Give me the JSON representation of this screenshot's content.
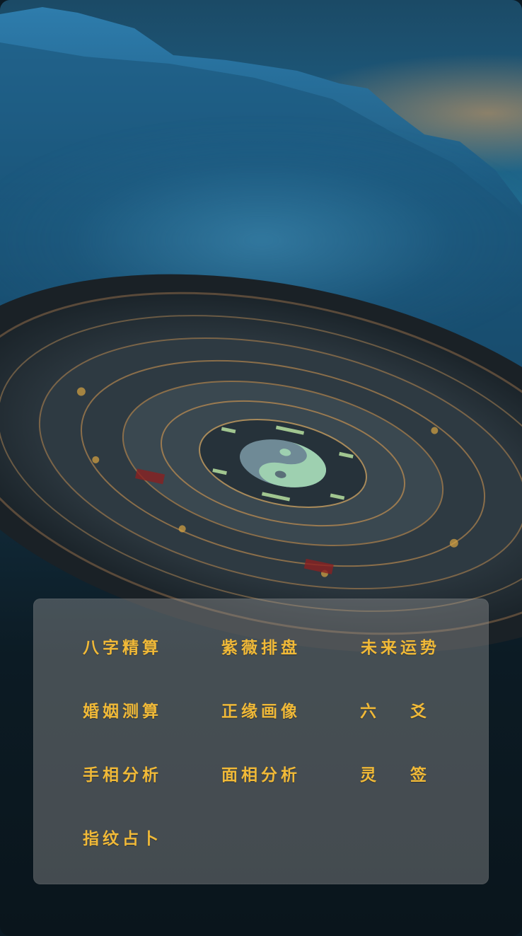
{
  "menu": {
    "items": [
      {
        "label": "八字精算"
      },
      {
        "label": "紫薇排盘"
      },
      {
        "label": "未来运势"
      },
      {
        "label": "婚姻测算"
      },
      {
        "label": "正缘画像"
      },
      {
        "label": "六 爻"
      },
      {
        "label": "手相分析"
      },
      {
        "label": "面相分析"
      },
      {
        "label": "灵 签"
      },
      {
        "label": "指纹占卜"
      }
    ]
  },
  "colors": {
    "label": "#f0b938",
    "panel": "rgba(150,150,150,0.42)",
    "sky": "#1f6a8e"
  },
  "background": {
    "scene": "mountain-mist-bagua-compass"
  }
}
